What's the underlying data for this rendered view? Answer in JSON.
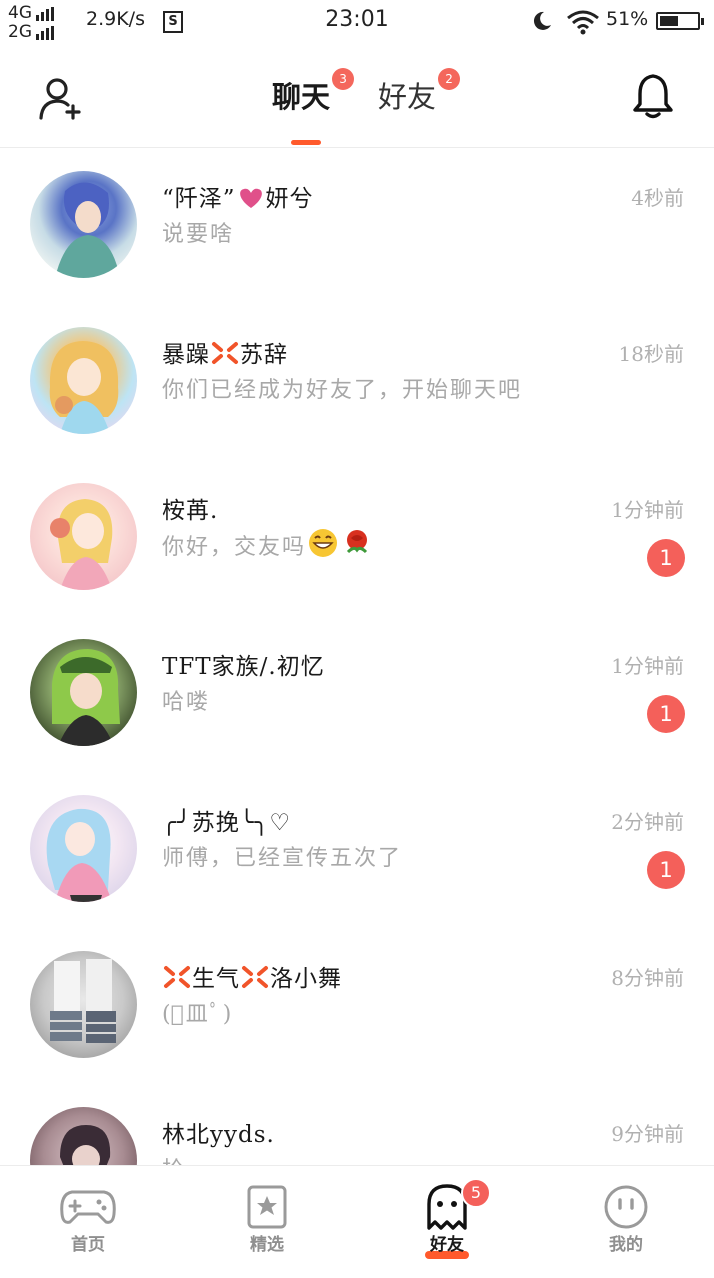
{
  "status_bar": {
    "network_top": "4G",
    "network_bottom": "2G",
    "speed": "2.9K/s",
    "s_icon": "S",
    "time": "23:01",
    "battery_percent": "51%",
    "battery_level": 0.51
  },
  "header": {
    "tabs": [
      {
        "label": "聊天",
        "badge": "3",
        "active": true
      },
      {
        "label": "好友",
        "badge": "2",
        "active": false
      }
    ],
    "icons": {
      "left": "add-friend-icon",
      "right": "bell-icon"
    }
  },
  "chats": [
    {
      "name": "“阡泽”",
      "name_suffix": "妍兮",
      "name_emoji": "heart",
      "preview": "说要啥",
      "time": "4秒前",
      "unread": ""
    },
    {
      "name": "暴躁",
      "name_suffix": "苏辞",
      "name_emoji": "anger",
      "preview": "你们已经成为好友了，开始聊天吧",
      "time": "18秒前",
      "unread": ""
    },
    {
      "name": "桉苒.",
      "name_suffix": "",
      "name_emoji": "",
      "preview": "你好，交友吗",
      "preview_emoji": "grin-rose",
      "time": "1分钟前",
      "unread": "1"
    },
    {
      "name": "TFT家族/.初忆",
      "name_suffix": "",
      "name_emoji": "",
      "preview": "哈喽",
      "time": "1分钟前",
      "unread": "1"
    },
    {
      "name": "╭╯苏挽╰╮♡",
      "name_suffix": "",
      "name_emoji": "",
      "preview": "师傅，已经宣传五次了",
      "time": "2分钟前",
      "unread": "1"
    },
    {
      "name": "生气",
      "name_suffix": "洛小舞",
      "name_emoji": "anger-both",
      "preview": "(ﾟ皿ﾟ)",
      "time": "8分钟前",
      "unread": ""
    },
    {
      "name": "林北yyds.",
      "name_suffix": "",
      "name_emoji": "",
      "preview": "拾。",
      "time": "9分钟前",
      "unread": ""
    }
  ],
  "bottom_nav": [
    {
      "label": "首页",
      "icon": "gamepad-icon",
      "active": false,
      "badge": ""
    },
    {
      "label": "精选",
      "icon": "star-bookmark-icon",
      "active": false,
      "badge": ""
    },
    {
      "label": "好友",
      "icon": "ghost-icon",
      "active": true,
      "badge": "5"
    },
    {
      "label": "我的",
      "icon": "smiley-icon",
      "active": false,
      "badge": ""
    }
  ],
  "colors": {
    "accent": "#ff5a2c",
    "badge": "#f4605a",
    "muted_text": "#a8a8a8"
  }
}
